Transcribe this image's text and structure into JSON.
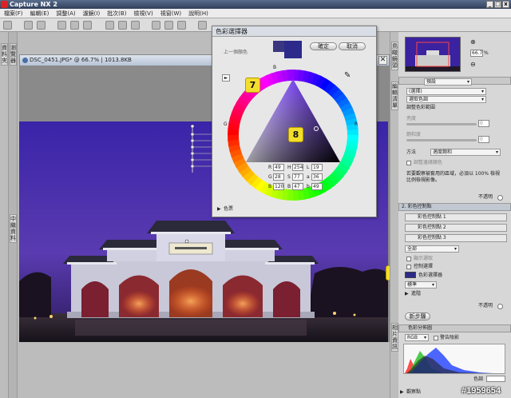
{
  "app": {
    "title": "Capture NX 2"
  },
  "menu": [
    "檔案(F)",
    "編輯(E)",
    "調整(A)",
    "濾鏡(I)",
    "批次(B)",
    "檢視(V)",
    "視窗(W)",
    "說明(H)"
  ],
  "left_strip": {
    "tab1": "資料夾",
    "tab2": "瀏覽器",
    "tab3": "中繼資料"
  },
  "document": {
    "tab_title": "DSC_0451.JPG* @ 66.7% | 1013.8KB",
    "close_glyph": "✕"
  },
  "dialog": {
    "title": "色彩選擇器",
    "prev_label": "上一個顏色",
    "ok_label": "確定",
    "cancel_label": "取消",
    "current_color": "#2c2a8a",
    "previous_color": "#3a3680",
    "ring_marks": {
      "b": "B",
      "g": "G",
      "r": "R"
    },
    "fields": {
      "R_label": "R",
      "R_value": "49",
      "G_label": "G",
      "G_value": "28",
      "B_label": "B",
      "B_value": "120",
      "H_label": "H",
      "H_value": "254",
      "S_label": "S",
      "S_value": "77",
      "Bv_label": "B",
      "Bv_value": "47",
      "L_label": "L",
      "L_value": "19",
      "a_label": "a",
      "a_value": "36",
      "b_label": "b",
      "b_value": "49"
    },
    "expander": "色票"
  },
  "callouts": {
    "c6": "6",
    "c7": "7",
    "c8": "8"
  },
  "right_strip": {
    "tab1": "鳥瞰鏡頭",
    "tab2": "編輯清單",
    "tab3": "相片資訊"
  },
  "right_panel": {
    "zoom_value": "66.7",
    "zoom_unit": "%",
    "preset_select": "預設",
    "mode_select": "(選擇)",
    "sub_select": "選取色調",
    "section_label": "調整色彩範圍",
    "slider1_label": "亮度",
    "slider1_value": "0",
    "slider2_label": "飽和度",
    "slider2_value": "0",
    "method_label": "方法",
    "method_value": "適度飽和",
    "checkbox_label": "調整邊緣顏色",
    "info_text": "若要觀察被套用的區域，必須以 100% 檢視比例檢視影像。",
    "opacity_label": "不透明",
    "cp_header": "2. 彩色控制點",
    "cp1": "彩色控制點 1",
    "cp2": "彩色控制點 2",
    "cp3": "彩色控制點 3",
    "mask_select": "全部",
    "show_mask": "顯示選取",
    "show_ctrl": "控制選擇",
    "color_picker_label": "色彩選擇器",
    "color_swatch": "#2c2a8a",
    "mode2_select": "標準",
    "advanced_label": "進階",
    "opacity2_label": "不透明",
    "new_step": "新步驟",
    "histogram_title": "色彩分佈圖",
    "hist_channel": "RGB",
    "hist_show": "警告陰影",
    "hist_tone_label": "色調",
    "add_point_label": "觀察點"
  },
  "watermark": "#1959654"
}
